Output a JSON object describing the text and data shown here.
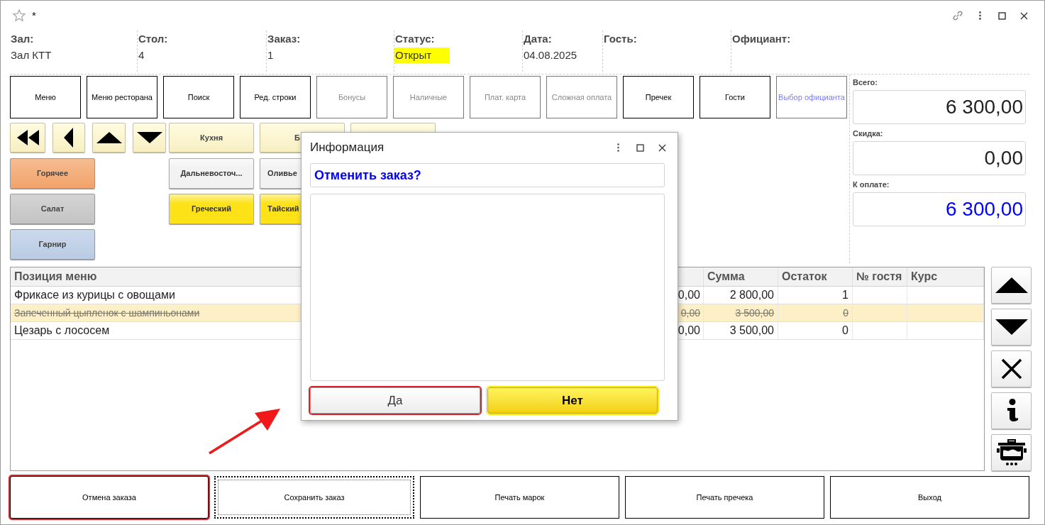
{
  "window": {
    "title": "*"
  },
  "header_fields": [
    {
      "label": "Зал:",
      "value": "Зал КТТ"
    },
    {
      "label": "Стол:",
      "value": "4"
    },
    {
      "label": "Заказ:",
      "value": "1"
    },
    {
      "label": "Статус:",
      "value": "Открыт",
      "color": "#ffff00"
    },
    {
      "label": "Дата:",
      "value": "04.08.2025"
    },
    {
      "label": "Гость:"
    },
    {
      "label": "Официант:"
    }
  ],
  "function_buttons": [
    {
      "label": "Меню",
      "kind": "enabled"
    },
    {
      "label": "Меню ресторана",
      "kind": "enabled"
    },
    {
      "label": "Поиск",
      "kind": "enabled"
    },
    {
      "label": "Ред. строки",
      "kind": "enabled"
    },
    {
      "label": "Бонусы",
      "kind": "disabled"
    },
    {
      "label": "Наличные",
      "kind": "disabled"
    },
    {
      "label": "Плат. карта",
      "kind": "disabled"
    },
    {
      "label": "Сложная оплата",
      "kind": "disabled"
    },
    {
      "label": "Пречек",
      "kind": "enabled"
    },
    {
      "label": "Гости",
      "kind": "enabled"
    },
    {
      "label": "Выбор официанта",
      "kind": "accent"
    }
  ],
  "nav_buttons": [
    {
      "kind": "first"
    },
    {
      "kind": "previous"
    },
    {
      "kind": "up"
    },
    {
      "kind": "down"
    }
  ],
  "category_buttons": [
    {
      "label": "Кухня",
      "kind": "plain"
    },
    {
      "label": "Б",
      "kind": "covered"
    },
    {
      "kind": "blank"
    }
  ],
  "group_buttons": [
    {
      "label": "Горячее",
      "color": "#f2a36a"
    },
    {
      "label": "Салат",
      "color": "#c4c4c4"
    },
    {
      "label": "Гарнир",
      "color": "#b9cbe4"
    }
  ],
  "dish_buttons": [
    {
      "label": "Дальневосточ...",
      "color": "#f2f2f2",
      "covered": false
    },
    {
      "label": "Оливье",
      "color": "#f2f2f2",
      "covered": true
    },
    {
      "label": "Греческий",
      "color": "#fde217",
      "covered": false
    },
    {
      "label": "Тайский",
      "color": "#fde217",
      "covered": true
    }
  ],
  "totals": [
    {
      "label": "Всего:",
      "value": "6 300,00",
      "emphasis": false
    },
    {
      "label": "Скидка:",
      "value": "0,00",
      "emphasis": false
    },
    {
      "label": "К оплате:",
      "value": "6 300,00",
      "emphasis": true
    }
  ],
  "table": {
    "columns": [
      "Позиция меню",
      "Сумма",
      "Остаток",
      "№ гостя",
      "Курс"
    ],
    "rows": [
      {
        "name": "Фрикасе из курицы с овощами",
        "column_2": "0,00",
        "sum": "2 800,00",
        "rest": "1",
        "selected": false,
        "cancelled": false
      },
      {
        "name": "Запеченный цыпленок с шампиньонами",
        "column_2": "0,00",
        "sum": "3 500,00",
        "rest": "0",
        "selected": true,
        "cancelled": true
      },
      {
        "name": "Цезарь с лососем",
        "column_2": "0,00",
        "sum": "3 500,00",
        "rest": "0",
        "selected": false,
        "cancelled": false
      }
    ]
  },
  "side_buttons": [
    {
      "kind": "up"
    },
    {
      "kind": "down"
    },
    {
      "kind": "delete"
    },
    {
      "kind": "info"
    },
    {
      "kind": "cook"
    }
  ],
  "bottom_buttons": [
    {
      "label": "Отмена заказа",
      "highlighted": true,
      "focused": false
    },
    {
      "label": "Сохранить заказ",
      "highlighted": false,
      "focused": true
    },
    {
      "label": "Печать марок",
      "highlighted": false,
      "focused": false
    },
    {
      "label": "Печать пречека",
      "highlighted": false,
      "focused": false
    },
    {
      "label": "Выход",
      "highlighted": false,
      "focused": false
    }
  ],
  "dialog": {
    "title": "Информация",
    "question": "Отменить заказ?",
    "buttons": [
      {
        "label": "Да",
        "kind": "default",
        "highlighted": true
      },
      {
        "label": "Нет",
        "kind": "primary",
        "highlighted": false
      }
    ]
  },
  "annotations": [
    {
      "kind": "arrow"
    }
  ]
}
